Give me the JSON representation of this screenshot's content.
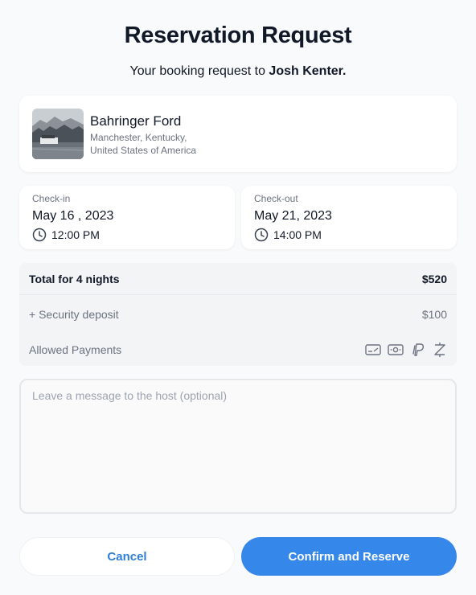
{
  "header": {
    "title": "Reservation Request",
    "subtitle_prefix": "Your booking request to",
    "host_name": "Josh Kenter."
  },
  "property": {
    "name": "Bahringer Ford",
    "address_line1": "Manchester, Kentucky,",
    "address_line2": "United States of America"
  },
  "checkin": {
    "label": "Check-in",
    "date": "May 16 , 2023",
    "time": "12:00 PM"
  },
  "checkout": {
    "label": "Check-out",
    "date": "May 21, 2023",
    "time": "14:00 PM"
  },
  "summary": {
    "total_label": "Total for 4 nights",
    "total_value": "$520",
    "deposit_label": "+ Security deposit",
    "deposit_value": "$100",
    "payments_label": "Allowed Payments",
    "payment_icons": [
      "credit-card-icon",
      "cash-icon",
      "paypal-icon",
      "zelle-icon"
    ]
  },
  "message": {
    "placeholder": "Leave a message to the host (optional)",
    "value": ""
  },
  "actions": {
    "cancel_label": "Cancel",
    "confirm_label": "Confirm and Reserve"
  },
  "colors": {
    "primary": "#3687ea",
    "cancel_text": "#2f7ed8",
    "muted_text": "#6b7280"
  }
}
